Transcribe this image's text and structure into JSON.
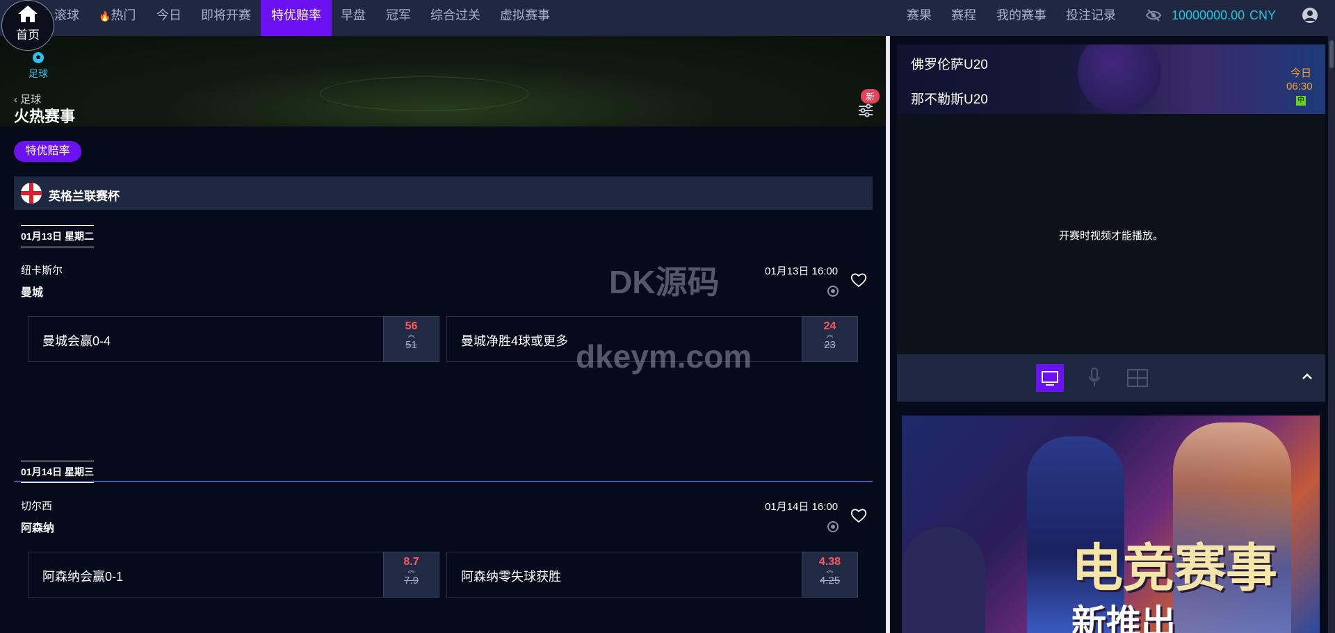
{
  "home": {
    "label": "首页"
  },
  "nav": {
    "items": [
      "滚球",
      "热门",
      "今日",
      "即将开赛",
      "特优赔率",
      "早盘",
      "冠军",
      "综合过关",
      "虚拟赛事"
    ],
    "right": [
      "赛果",
      "赛程",
      "我的赛事",
      "投注记录"
    ],
    "balance": "10000000.00",
    "currency": "CNY"
  },
  "banner": {
    "sport_tab": "足球",
    "back_label": "足球",
    "title": "火热赛事",
    "new_badge": "新"
  },
  "filter_pill": "特优赔率",
  "league": {
    "name": "英格兰联赛杯"
  },
  "matches": [
    {
      "date": "01月13日 星期二",
      "team_home": "纽卡斯尔",
      "team_away": "曼城",
      "time": "01月13日 16:00",
      "bets": [
        {
          "label": "曼城会赢0-4",
          "odds": "56",
          "old_odds": "51"
        },
        {
          "label": "曼城净胜4球或更多",
          "odds": "24",
          "old_odds": "23"
        }
      ]
    },
    {
      "date": "01月14日 星期三",
      "team_home": "切尔西",
      "team_away": "阿森纳",
      "time": "01月14日 16:00",
      "bets": [
        {
          "label": "阿森纳会赢0-1",
          "odds": "8.7",
          "old_odds": "7.9"
        },
        {
          "label": "阿森纳零失球获胜",
          "odds": "4.38",
          "old_odds": "4.25"
        }
      ]
    }
  ],
  "watermark": {
    "line1": "DK源码",
    "line2": "dkeym.com"
  },
  "live": {
    "team1": "佛罗伦萨U20",
    "team2": "那不勒斯U20",
    "day": "今日",
    "time": "06:30",
    "badge": "中",
    "video_message": "开赛时视频才能播放。"
  },
  "promo": {
    "title": "电竞赛事",
    "subtitle": "新推出"
  },
  "colors": {
    "accent": "#6c12f0",
    "nav_bg": "#1f2741",
    "balance": "#21c6e0",
    "odds": "#ff5a5a"
  }
}
